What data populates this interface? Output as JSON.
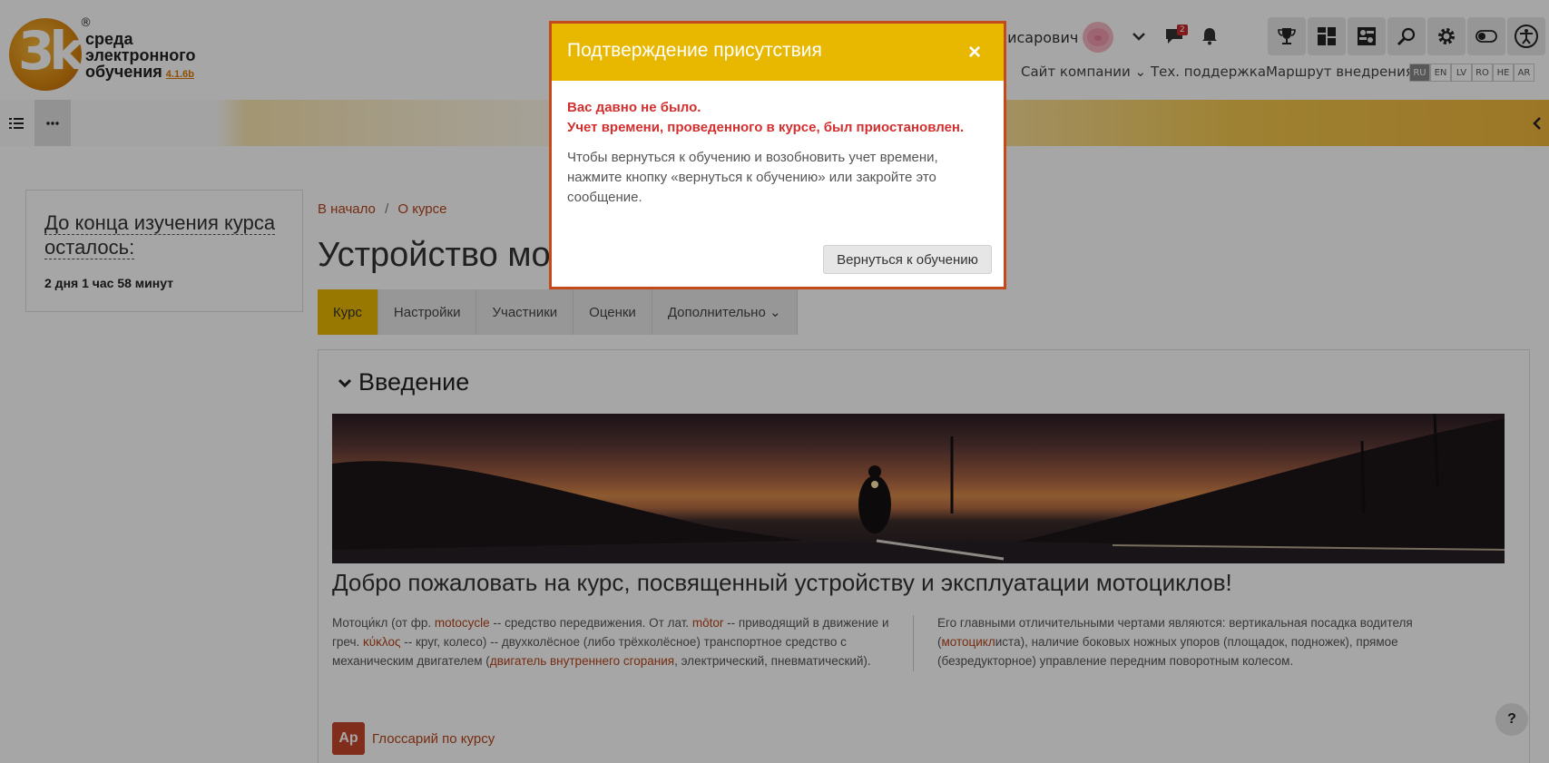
{
  "header": {
    "logo": {
      "line1": "среда",
      "line2": "электронного",
      "line3": "обучения",
      "version": "4.1.6b",
      "reg": "®",
      "mark": "3k"
    },
    "user_name": "мисарович",
    "notif_count": "2",
    "nav": {
      "company_site": "Сайт компании ⌄",
      "support": "Тех. поддержка",
      "route": "Маршрут внедрения"
    },
    "languages": [
      "RU",
      "EN",
      "LV",
      "RO",
      "HE",
      "AR"
    ],
    "active_language": "RU"
  },
  "toolbar": {
    "list_icon": "list-icon",
    "more_icon": "more-icon",
    "collapse_icon": "chevron-left-icon"
  },
  "time_block": {
    "title": "До конца изучения курса осталось:",
    "remaining": "2 дня 1 час 58 минут"
  },
  "breadcrumb": {
    "home": "В начало",
    "separator": "/",
    "current": "О курсе"
  },
  "page_title": "Устройство мо",
  "tabs": [
    {
      "label": "Курс"
    },
    {
      "label": "Настройки"
    },
    {
      "label": "Участники"
    },
    {
      "label": "Оценки"
    },
    {
      "label": "Дополнительно ⌄"
    }
  ],
  "section": {
    "title": "Введение",
    "welcome": "Добро пожаловать на курс, посвященный устройству и эксплуатации мотоциклов!",
    "left_col": {
      "t1": "Мотоци́кл (от фр. ",
      "l1": "motocycle",
      "t2": " -- средство передвижения. От лат. ",
      "l2": "mōtor",
      "t3": " -- приводящий в движение и греч. ",
      "l3": "κύκλος",
      "t4": " -- круг, колесо) -- двухколёсное (либо трёхколёсное) транспортное средство с механическим двигателем (",
      "l4": "двигатель внутреннего сгорания",
      "t5": ", электрический, пневматический)."
    },
    "right_col": {
      "t1": "Его главными отличительными чертами являются: вертикальная посадка водителя (",
      "l1": "мотоцикл",
      "t2": "иста), наличие боковых ножных упоров (площадок, подножек), прямое (безредукторное) управление передним поворотным колесом."
    },
    "glossary": {
      "icon": "Ар",
      "label": "Глоссарий по курсу"
    }
  },
  "help": "?",
  "modal": {
    "title": "Подтверждение присутствия",
    "close": "×",
    "warn_line1": "Вас давно не было.",
    "warn_line2": "Учет времени, проведенного в курсе, был приостановлен.",
    "body": "Чтобы вернуться к обучению и возобновить учет времени, нажмите кнопку «вернуться к обучению» или закройте это сообщение.",
    "button": "Вернуться к обучению"
  },
  "colors": {
    "accent": "#e8b800",
    "link": "#b5441a",
    "warning": "#d32f2f",
    "modal_border": "#c44a1c"
  }
}
